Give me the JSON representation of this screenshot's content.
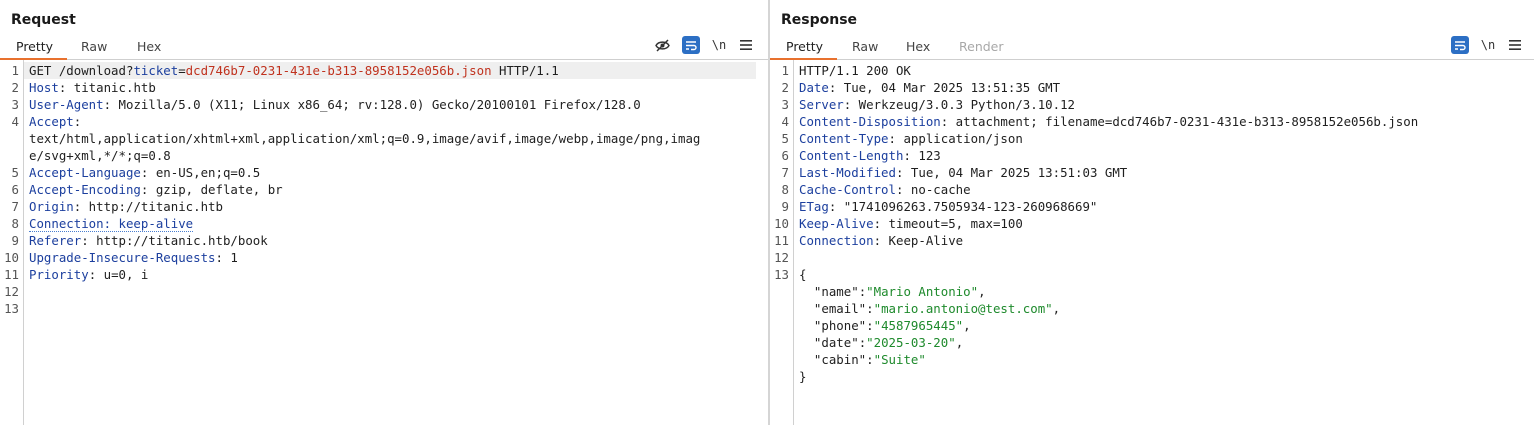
{
  "request": {
    "title": "Request",
    "tabs": [
      "Pretty",
      "Raw",
      "Hex"
    ],
    "active_tab": "Pretty",
    "toolbar": {
      "hide_icon": "eye-off-icon",
      "wrap_icon": "word-wrap-icon",
      "newline_label": "\\n",
      "menu_icon": "hamburger-menu-icon"
    },
    "lines": [
      {
        "n": "1",
        "parts": [
          {
            "t": "GET /download?",
            "c": "v"
          },
          {
            "t": "ticket",
            "c": "param"
          },
          {
            "t": "=",
            "c": "v"
          },
          {
            "t": "dcd746b7-0231-431e-b313-8958152e056b.json",
            "c": "pval"
          },
          {
            "t": " HTTP/1.1",
            "c": "v"
          }
        ],
        "highlight": true
      },
      {
        "n": "2",
        "parts": [
          {
            "t": "Host",
            "c": "k"
          },
          {
            "t": ": titanic.htb",
            "c": "v"
          }
        ]
      },
      {
        "n": "3",
        "parts": [
          {
            "t": "User-Agent",
            "c": "k"
          },
          {
            "t": ": Mozilla/5.0 (X11; Linux x86_64; rv:128.0) Gecko/20100101 Firefox/128.0",
            "c": "v"
          }
        ]
      },
      {
        "n": "4",
        "parts": [
          {
            "t": "Accept",
            "c": "k"
          },
          {
            "t": ":",
            "c": "v"
          }
        ]
      },
      {
        "n": "",
        "parts": [
          {
            "t": "text/html,application/xhtml+xml,application/xml;q=0.9,image/avif,image/webp,image/png,imag",
            "c": "v"
          }
        ]
      },
      {
        "n": "",
        "parts": [
          {
            "t": "e/svg+xml,*/*;q=0.8",
            "c": "v"
          }
        ]
      },
      {
        "n": "5",
        "parts": [
          {
            "t": "Accept-Language",
            "c": "k"
          },
          {
            "t": ": en-US,en;q=0.5",
            "c": "v"
          }
        ]
      },
      {
        "n": "6",
        "parts": [
          {
            "t": "Accept-Encoding",
            "c": "k"
          },
          {
            "t": ": gzip, deflate, br",
            "c": "v"
          }
        ]
      },
      {
        "n": "7",
        "parts": [
          {
            "t": "Origin",
            "c": "k"
          },
          {
            "t": ": http://titanic.htb",
            "c": "v"
          }
        ]
      },
      {
        "n": "8",
        "parts": [
          {
            "t": "Connection: keep-alive",
            "c": "k dotted"
          }
        ]
      },
      {
        "n": "9",
        "parts": [
          {
            "t": "Referer",
            "c": "k"
          },
          {
            "t": ": http://titanic.htb/book",
            "c": "v"
          }
        ]
      },
      {
        "n": "10",
        "parts": [
          {
            "t": "Upgrade-Insecure-Requests",
            "c": "k"
          },
          {
            "t": ": 1",
            "c": "v"
          }
        ]
      },
      {
        "n": "11",
        "parts": [
          {
            "t": "Priority",
            "c": "k"
          },
          {
            "t": ": u=0, i",
            "c": "v"
          }
        ]
      },
      {
        "n": "12",
        "parts": []
      },
      {
        "n": "13",
        "parts": []
      }
    ]
  },
  "response": {
    "title": "Response",
    "tabs": [
      "Pretty",
      "Raw",
      "Hex",
      "Render"
    ],
    "active_tab": "Pretty",
    "toolbar": {
      "wrap_icon": "word-wrap-icon",
      "newline_label": "\\n",
      "menu_icon": "hamburger-menu-icon"
    },
    "lines": [
      {
        "n": "1",
        "parts": [
          {
            "t": "HTTP/1.1 200 OK",
            "c": "v"
          }
        ]
      },
      {
        "n": "2",
        "parts": [
          {
            "t": "Date",
            "c": "k"
          },
          {
            "t": ": Tue, 04 Mar 2025 13:51:35 GMT",
            "c": "v"
          }
        ]
      },
      {
        "n": "3",
        "parts": [
          {
            "t": "Server",
            "c": "k"
          },
          {
            "t": ": Werkzeug/3.0.3 Python/3.10.12",
            "c": "v"
          }
        ]
      },
      {
        "n": "4",
        "parts": [
          {
            "t": "Content-Disposition",
            "c": "k"
          },
          {
            "t": ": attachment; filename=dcd746b7-0231-431e-b313-8958152e056b.json",
            "c": "v"
          }
        ]
      },
      {
        "n": "5",
        "parts": [
          {
            "t": "Content-Type",
            "c": "k"
          },
          {
            "t": ": application/json",
            "c": "v"
          }
        ]
      },
      {
        "n": "6",
        "parts": [
          {
            "t": "Content-Length",
            "c": "k"
          },
          {
            "t": ": 123",
            "c": "v"
          }
        ]
      },
      {
        "n": "7",
        "parts": [
          {
            "t": "Last-Modified",
            "c": "k"
          },
          {
            "t": ": Tue, 04 Mar 2025 13:51:03 GMT",
            "c": "v"
          }
        ]
      },
      {
        "n": "8",
        "parts": [
          {
            "t": "Cache-Control",
            "c": "k"
          },
          {
            "t": ": no-cache",
            "c": "v"
          }
        ]
      },
      {
        "n": "9",
        "parts": [
          {
            "t": "ETag",
            "c": "k"
          },
          {
            "t": ": \"1741096263.7505934-123-260968669\"",
            "c": "v"
          }
        ]
      },
      {
        "n": "10",
        "parts": [
          {
            "t": "Keep-Alive",
            "c": "k"
          },
          {
            "t": ": timeout=5, max=100",
            "c": "v"
          }
        ]
      },
      {
        "n": "11",
        "parts": [
          {
            "t": "Connection",
            "c": "k"
          },
          {
            "t": ": Keep-Alive",
            "c": "v"
          }
        ]
      },
      {
        "n": "12",
        "parts": []
      },
      {
        "n": "13",
        "parts": [
          {
            "t": "{",
            "c": "v"
          }
        ]
      },
      {
        "n": "",
        "parts": [
          {
            "t": "  \"name\"",
            "c": "jkey"
          },
          {
            "t": ":",
            "c": "v"
          },
          {
            "t": "\"Mario Antonio\"",
            "c": "jstr"
          },
          {
            "t": ",",
            "c": "v"
          }
        ]
      },
      {
        "n": "",
        "parts": [
          {
            "t": "  \"email\"",
            "c": "jkey"
          },
          {
            "t": ":",
            "c": "v"
          },
          {
            "t": "\"mario.antonio@test.com\"",
            "c": "jstr"
          },
          {
            "t": ",",
            "c": "v"
          }
        ]
      },
      {
        "n": "",
        "parts": [
          {
            "t": "  \"phone\"",
            "c": "jkey"
          },
          {
            "t": ":",
            "c": "v"
          },
          {
            "t": "\"4587965445\"",
            "c": "jstr"
          },
          {
            "t": ",",
            "c": "v"
          }
        ]
      },
      {
        "n": "",
        "parts": [
          {
            "t": "  \"date\"",
            "c": "jkey"
          },
          {
            "t": ":",
            "c": "v"
          },
          {
            "t": "\"2025-03-20\"",
            "c": "jstr"
          },
          {
            "t": ",",
            "c": "v"
          }
        ]
      },
      {
        "n": "",
        "parts": [
          {
            "t": "  \"cabin\"",
            "c": "jkey"
          },
          {
            "t": ":",
            "c": "v"
          },
          {
            "t": "\"Suite\"",
            "c": "jstr"
          }
        ]
      },
      {
        "n": "",
        "parts": [
          {
            "t": "}",
            "c": "v"
          }
        ]
      }
    ]
  },
  "colors": {
    "accent": "#e8712e",
    "toggle_blue": "#2c6fc4",
    "header_key": "#1c3f9e",
    "param_value": "#c0321e",
    "json_string": "#1e8a2c"
  }
}
